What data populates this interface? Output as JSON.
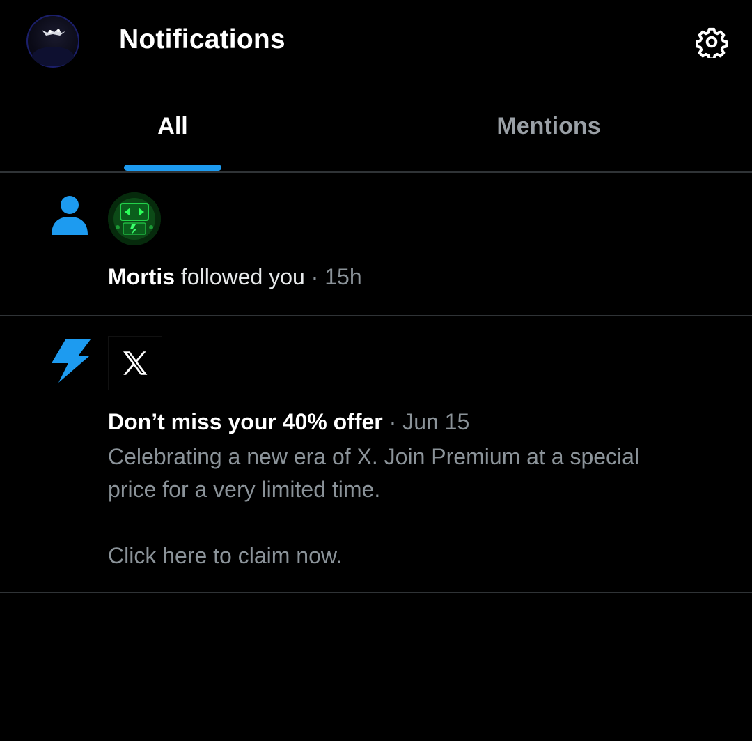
{
  "header": {
    "title": "Notifications",
    "settings_icon": "gear-icon",
    "avatar_icon": "avatar"
  },
  "tabs": [
    {
      "label": "All",
      "selected": true
    },
    {
      "label": "Mentions",
      "selected": false
    }
  ],
  "colors": {
    "accent": "#1d9bf0",
    "background": "#000000",
    "divider": "#2f3336",
    "muted_text": "#8b9399"
  },
  "notifications": [
    {
      "type_icon": "person-icon",
      "name": "Mortis",
      "action": "followed you",
      "separator": "·",
      "time": "15h"
    },
    {
      "type_icon": "lightning-icon",
      "logo_icon": "x-logo-icon",
      "title": "Don’t miss your 40% offer",
      "separator": "·",
      "time": "Jun 15",
      "body_line1": "Celebrating a new era of X. Join Premium at a special",
      "body_line2": "price for a very limited time.",
      "body_cta": "Click here to claim now."
    }
  ]
}
